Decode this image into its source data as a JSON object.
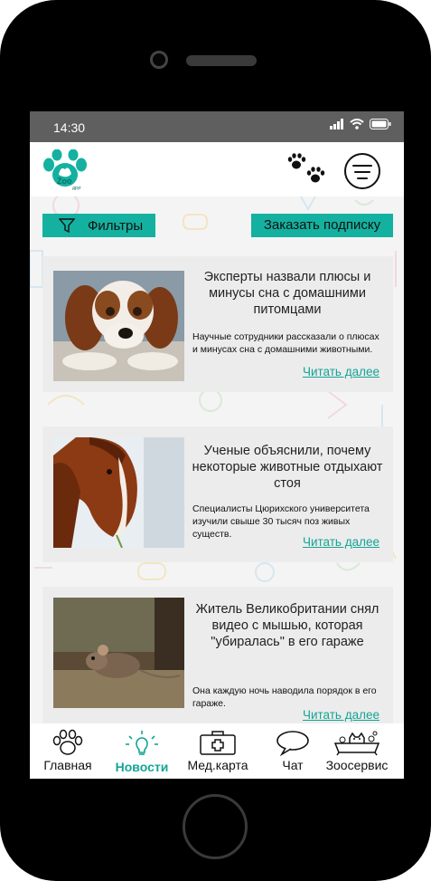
{
  "status": {
    "time": "14:30"
  },
  "header": {
    "logo_text": "Zoo",
    "logo_subtext": "друг"
  },
  "toolbar": {
    "filters_label": "Фильтры",
    "subscribe_label": "Заказать подписку"
  },
  "news": [
    {
      "title": "Эксперты назвали плюсы и минусы сна с домашними питомцами",
      "description": "Научные сотрудники рассказали о плюсах и минусах сна с домашними животными.",
      "more": "Читать далее",
      "image": "dog-photo"
    },
    {
      "title": "Ученые объяснили, почему некоторые животные отдыхают стоя",
      "description": "Специалисты Цюрихского университета изучили свыше 30 тысяч поз живых существ.",
      "more": "Читать далее",
      "image": "horse-photo"
    },
    {
      "title": "Житель Великобритании снял видео с мышью, которая \"убиралась\" в его гараже",
      "description": "Она каждую ночь наводила порядок в его гараже.",
      "more": "Читать далее",
      "image": "mouse-photo"
    }
  ],
  "nav": {
    "items": [
      {
        "label": "Главная",
        "icon": "paw-icon"
      },
      {
        "label": "Новости",
        "icon": "lightbulb-icon"
      },
      {
        "label": "Мед.карта",
        "icon": "medkit-icon"
      },
      {
        "label": "Чат",
        "icon": "chat-icon"
      },
      {
        "label": "Зоосервис",
        "icon": "cat-bath-icon"
      }
    ],
    "active": "Новости"
  },
  "colors": {
    "accent": "#14b1a1",
    "link": "#14a595",
    "statusbar": "#5f5f5f",
    "card_bg": "#ececec"
  }
}
